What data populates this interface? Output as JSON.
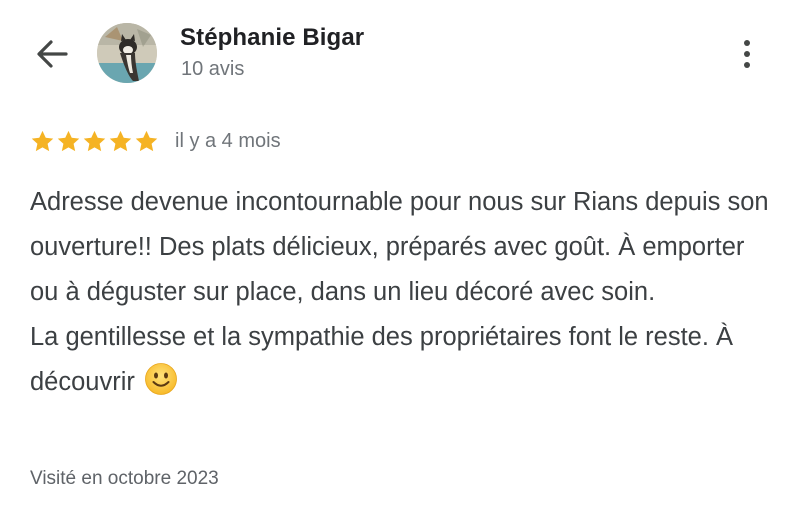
{
  "header": {
    "back_icon": "arrow-left-icon",
    "reviewer_name": "Stéphanie Bigar",
    "review_count": "10 avis",
    "more_icon": "more-vert-icon"
  },
  "review": {
    "rating": 5,
    "rating_max": 5,
    "star_color": "#f5b324",
    "date": "il y a 4 mois",
    "paragraph_1": "Adresse devenue incontournable pour nous sur Rians depuis son ouverture!! Des plats délicieux, préparés avec goût. À emporter ou à déguster sur place, dans un lieu décoré avec soin.",
    "paragraph_2": "La gentillesse et la sympathie des propriétaires font le reste. À découvrir",
    "emoji": "slightly-smiling-face-emoji",
    "visit": "Visité en octobre 2023"
  }
}
